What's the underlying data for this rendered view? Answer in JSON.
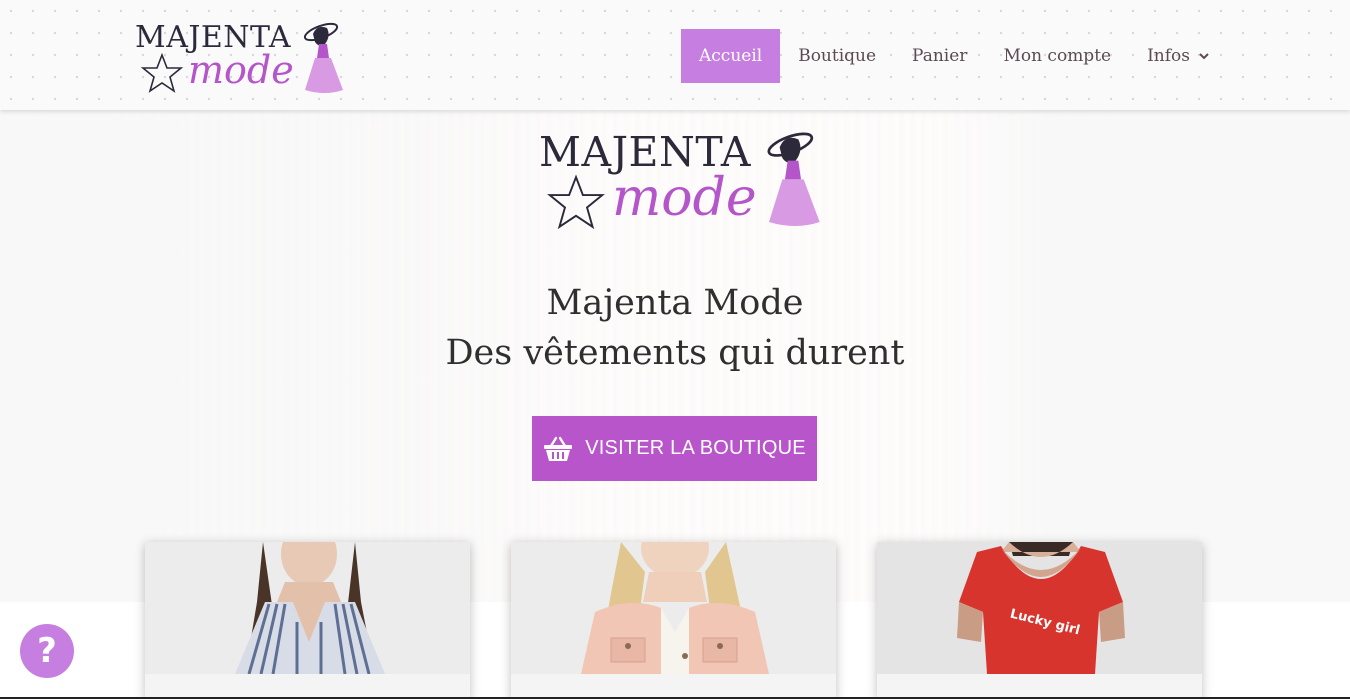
{
  "brand": {
    "logo_word": "Majenta",
    "logo_script": "mode"
  },
  "nav": {
    "items": [
      {
        "label": "Accueil",
        "active": true
      },
      {
        "label": "Boutique",
        "active": false
      },
      {
        "label": "Panier",
        "active": false
      },
      {
        "label": "Mon compte",
        "active": false
      },
      {
        "label": "Infos",
        "active": false,
        "has_dropdown": true
      }
    ]
  },
  "hero": {
    "title_line1": "Majenta Mode",
    "title_line2": "Des vêtements qui durent",
    "cta_label": "VISITER LA BOUTIQUE",
    "cta_icon": "basket-icon"
  },
  "products": [
    {
      "name": "striped-shirt"
    },
    {
      "name": "pink-denim-jacket"
    },
    {
      "name": "red-lucky-girl-bodysuit",
      "print_text": "Lucky girl"
    }
  ],
  "help": {
    "label": "?"
  },
  "colors": {
    "accent": "#c67fe0",
    "cta": "#b855cb",
    "logo_script": "#b455c9",
    "logo_text": "#2c2a3a"
  }
}
